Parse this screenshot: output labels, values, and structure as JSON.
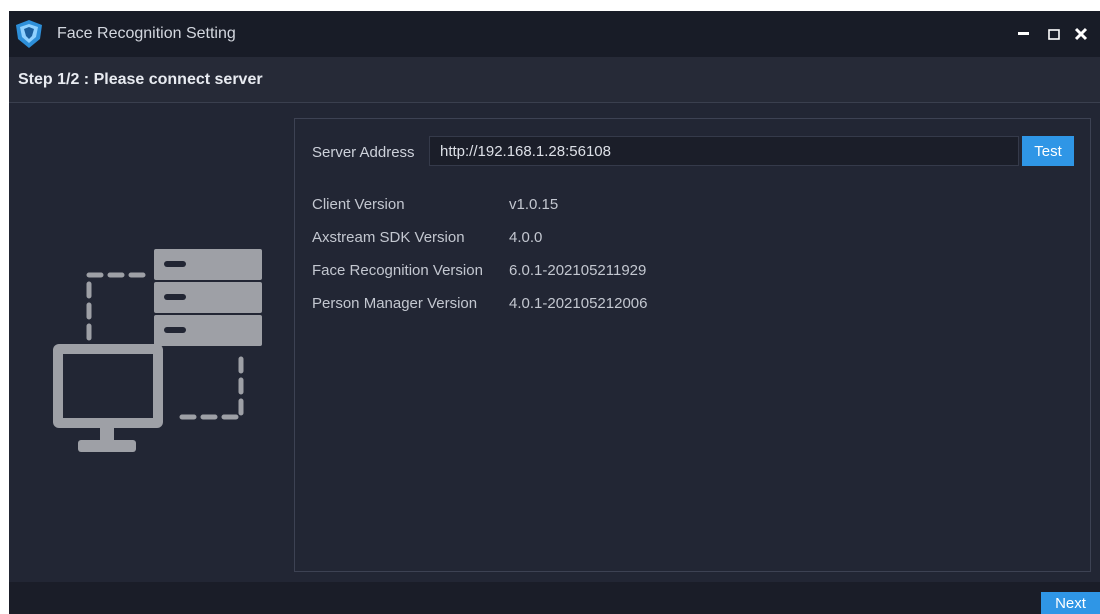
{
  "window": {
    "title": "Face Recognition Setting",
    "controls": {
      "minimize_icon": "minimize-icon",
      "maximize_icon": "maximize-icon",
      "close_icon": "close-icon"
    }
  },
  "step": {
    "title": "Step 1/2 : Please connect server"
  },
  "server": {
    "address_label": "Server Address",
    "address_value": "http://192.168.1.28:56108",
    "test_label": "Test"
  },
  "versions": [
    {
      "label": "Client Version",
      "value": "v1.0.15"
    },
    {
      "label": "Axstream SDK Version",
      "value": "4.0.0"
    },
    {
      "label": "Face Recognition Version",
      "value": "6.0.1-202105211929"
    },
    {
      "label": "Person Manager Version",
      "value": "4.0.1-202105212006"
    }
  ],
  "footer": {
    "next_label": "Next"
  },
  "colors": {
    "accent": "#2f96e6",
    "titlebar_bg": "#181c27",
    "window_bg": "#222634",
    "illustration": "#9ea0a6"
  }
}
